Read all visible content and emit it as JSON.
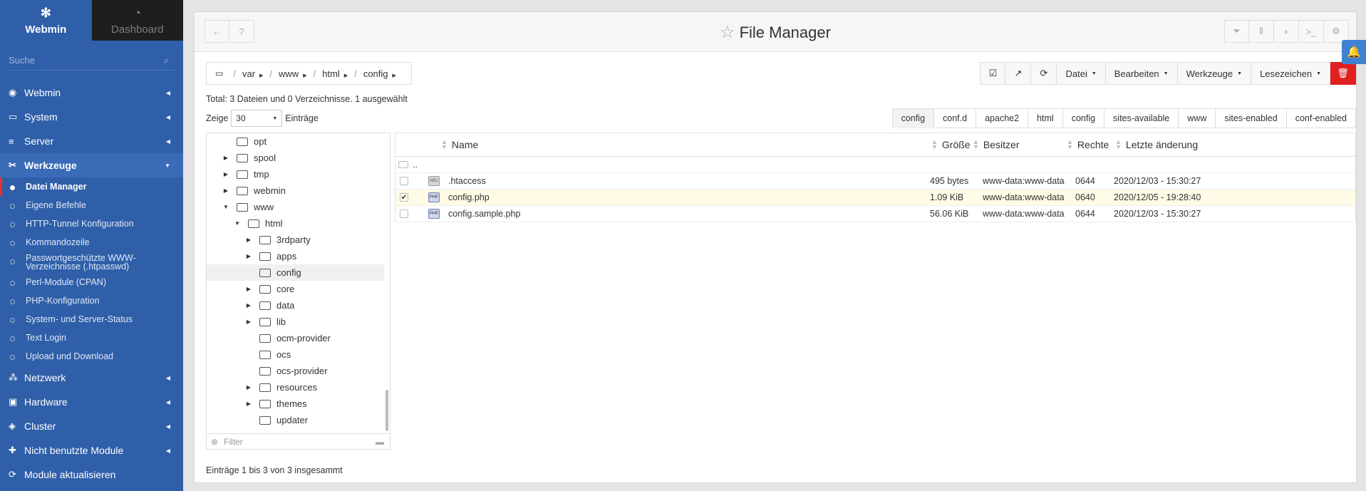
{
  "sidebar": {
    "brand": {
      "webmin": "Webmin",
      "dashboard": "Dashboard"
    },
    "search_placeholder": "Suche",
    "items": [
      {
        "label": "Webmin",
        "icon": "gauge-icon"
      },
      {
        "label": "System",
        "icon": "laptop-icon"
      },
      {
        "label": "Server",
        "icon": "server-icon"
      },
      {
        "label": "Werkzeuge",
        "icon": "tools-icon"
      }
    ],
    "subitems": [
      "Datei Manager",
      "Eigene Befehle",
      "HTTP-Tunnel Konfiguration",
      "Kommandozeile",
      "Passwortgeschützte WWW-Verzeichnisse (.htpasswd)",
      "Perl-Module (CPAN)",
      "PHP-Konfiguration",
      "System- und Server-Status",
      "Text Login",
      "Upload und Download"
    ],
    "items_after": [
      {
        "label": "Netzwerk",
        "icon": "network-icon"
      },
      {
        "label": "Hardware",
        "icon": "hdd-icon"
      },
      {
        "label": "Cluster",
        "icon": "layers-icon"
      },
      {
        "label": "Nicht benutzte Module",
        "icon": "puzzle-icon"
      },
      {
        "label": "Module aktualisieren",
        "icon": "refresh-icon"
      }
    ]
  },
  "header": {
    "title": "File Manager"
  },
  "breadcrumb": [
    "var",
    "www",
    "html",
    "config"
  ],
  "actions": {
    "datei": "Datei",
    "bearbeiten": "Bearbeiten",
    "werkzeuge": "Werkzeuge",
    "lesezeichen": "Lesezeichen"
  },
  "summary": "Total: 3 Dateien und 0 Verzeichnisse. 1 ausgewählt",
  "show": {
    "prefix": "Zeige",
    "value": "30",
    "suffix": "Einträge"
  },
  "tabs": [
    "config",
    "conf.d",
    "apache2",
    "html",
    "config",
    "sites-available",
    "www",
    "sites-enabled",
    "conf-enabled"
  ],
  "tree": {
    "rows": [
      {
        "label": "opt",
        "indent": 0,
        "arrow": "",
        "open": false
      },
      {
        "label": "spool",
        "indent": 0,
        "arrow": "right",
        "open": false
      },
      {
        "label": "tmp",
        "indent": 0,
        "arrow": "right",
        "open": false
      },
      {
        "label": "webmin",
        "indent": 0,
        "arrow": "right",
        "open": false
      },
      {
        "label": "www",
        "indent": 0,
        "arrow": "down",
        "open": true
      },
      {
        "label": "html",
        "indent": 1,
        "arrow": "down",
        "open": true
      },
      {
        "label": "3rdparty",
        "indent": 2,
        "arrow": "right",
        "open": false
      },
      {
        "label": "apps",
        "indent": 2,
        "arrow": "right",
        "open": false
      },
      {
        "label": "config",
        "indent": 2,
        "arrow": "",
        "open": true,
        "selected": true
      },
      {
        "label": "core",
        "indent": 2,
        "arrow": "right",
        "open": false
      },
      {
        "label": "data",
        "indent": 2,
        "arrow": "right",
        "open": false
      },
      {
        "label": "lib",
        "indent": 2,
        "arrow": "right",
        "open": false
      },
      {
        "label": "ocm-provider",
        "indent": 2,
        "arrow": "",
        "open": false
      },
      {
        "label": "ocs",
        "indent": 2,
        "arrow": "",
        "open": false
      },
      {
        "label": "ocs-provider",
        "indent": 2,
        "arrow": "",
        "open": false
      },
      {
        "label": "resources",
        "indent": 2,
        "arrow": "right",
        "open": false
      },
      {
        "label": "themes",
        "indent": 2,
        "arrow": "right",
        "open": false
      },
      {
        "label": "updater",
        "indent": 2,
        "arrow": "",
        "open": false
      }
    ],
    "filter_placeholder": "Filter"
  },
  "table": {
    "headers": {
      "name": "Name",
      "size": "Größe",
      "owner": "Besitzer",
      "perms": "Rechte",
      "modified": "Letzte änderung"
    },
    "parent": "..",
    "rows": [
      {
        "name": ".htaccess",
        "type": "ABC",
        "size": "495 bytes",
        "owner": "www-data:www-data",
        "perms": "0644",
        "modified": "2020/12/03 - 15:30:27",
        "checked": false
      },
      {
        "name": "config.php",
        "type": "PHP",
        "size": "1.09 KiB",
        "owner": "www-data:www-data",
        "perms": "0640",
        "modified": "2020/12/05 - 19:28:40",
        "checked": true
      },
      {
        "name": "config.sample.php",
        "type": "PHP",
        "size": "56.06 KiB",
        "owner": "www-data:www-data",
        "perms": "0644",
        "modified": "2020/12/03 - 15:30:27",
        "checked": false
      }
    ]
  },
  "footer": "Einträge 1 bis 3 von 3 insgesammt"
}
